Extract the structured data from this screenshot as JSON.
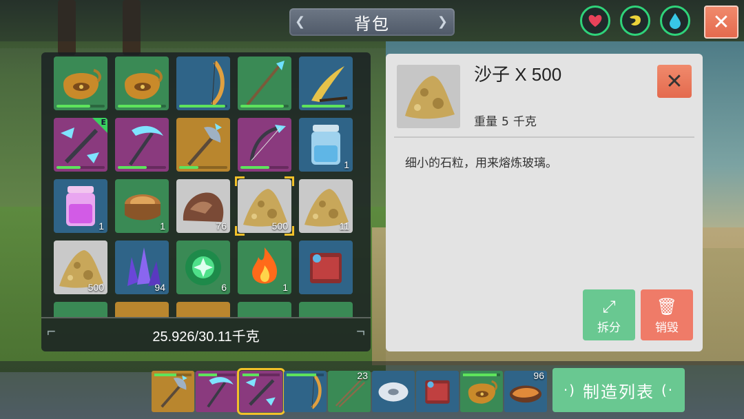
{
  "top": {
    "title": "背包",
    "status_icons": [
      "heart-icon",
      "stomach-icon",
      "water-drop-icon"
    ],
    "close_icon": "close-icon"
  },
  "inventory": {
    "rows": [
      [
        {
          "name": "pouch",
          "bg": "green",
          "durability": 0.7
        },
        {
          "name": "pouch",
          "bg": "green",
          "durability": 0.9
        },
        {
          "name": "bow",
          "bg": "blue",
          "durability": 0.95
        },
        {
          "name": "crystal-spear",
          "bg": "green",
          "durability": 0.9
        },
        {
          "name": "golden-sickle",
          "bg": "blue",
          "durability": 0.9
        }
      ],
      [
        {
          "name": "crystal-crossbow",
          "bg": "purple",
          "durability": 0.5,
          "equipped": "E"
        },
        {
          "name": "crystal-pickaxe",
          "bg": "purple",
          "durability": 0.6
        },
        {
          "name": "crystal-axe",
          "bg": "orange",
          "durability": 0.4
        },
        {
          "name": "crystal-bow",
          "bg": "purple",
          "durability": 0.6
        },
        {
          "name": "water-jar",
          "bg": "blue",
          "count": "1"
        }
      ],
      [
        {
          "name": "pink-jar",
          "bg": "blue",
          "count": "1"
        },
        {
          "name": "log",
          "bg": "green",
          "count": "1"
        },
        {
          "name": "stone",
          "bg": "grey",
          "count": "76"
        },
        {
          "name": "sand",
          "bg": "grey",
          "count": "500",
          "selected": true
        },
        {
          "name": "sand",
          "bg": "grey",
          "count": "11"
        }
      ],
      [
        {
          "name": "sand",
          "bg": "grey",
          "count": "500"
        },
        {
          "name": "purple-crystal",
          "bg": "blue",
          "count": "94"
        },
        {
          "name": "green-orb",
          "bg": "green",
          "count": "6"
        },
        {
          "name": "flame",
          "bg": "green",
          "count": "1"
        },
        {
          "name": "camera",
          "bg": "blue"
        }
      ]
    ],
    "weight_text": "25.926/30.11千克"
  },
  "detail": {
    "item_name": "沙子 X 500",
    "weight_label": "重量",
    "weight_value": "5",
    "weight_unit": "千克",
    "description": "细小的石粒，用来熔炼玻璃。",
    "split_label": "拆分",
    "destroy_label": "销毁"
  },
  "hotbar": {
    "slots": [
      {
        "name": "crystal-axe",
        "bg": "#b9862e",
        "durability": 0.6
      },
      {
        "name": "crystal-pickaxe",
        "bg": "#8a3a7e",
        "durability": 0.5
      },
      {
        "name": "crystal-crossbow",
        "bg": "#8a3a7e",
        "durability": 0.45,
        "selected": true
      },
      {
        "name": "bow",
        "bg": "#2f6488",
        "durability": 0.8
      },
      {
        "name": "arrows",
        "bg": "#3a8a55",
        "count": "23"
      },
      {
        "name": "shell-disk",
        "bg": "#2f6488"
      },
      {
        "name": "camera",
        "bg": "#2f6488"
      },
      {
        "name": "pouch",
        "bg": "#3a8a55",
        "durability": 0.9
      },
      {
        "name": "cooked-meat",
        "bg": "#2f6488",
        "count": "96"
      }
    ],
    "craft_label": "制造列表"
  },
  "colors": {
    "selected_frame": "#f3c12a",
    "action_green": "#69c891",
    "action_red": "#ef7b68",
    "durability": "#5ee35c"
  }
}
